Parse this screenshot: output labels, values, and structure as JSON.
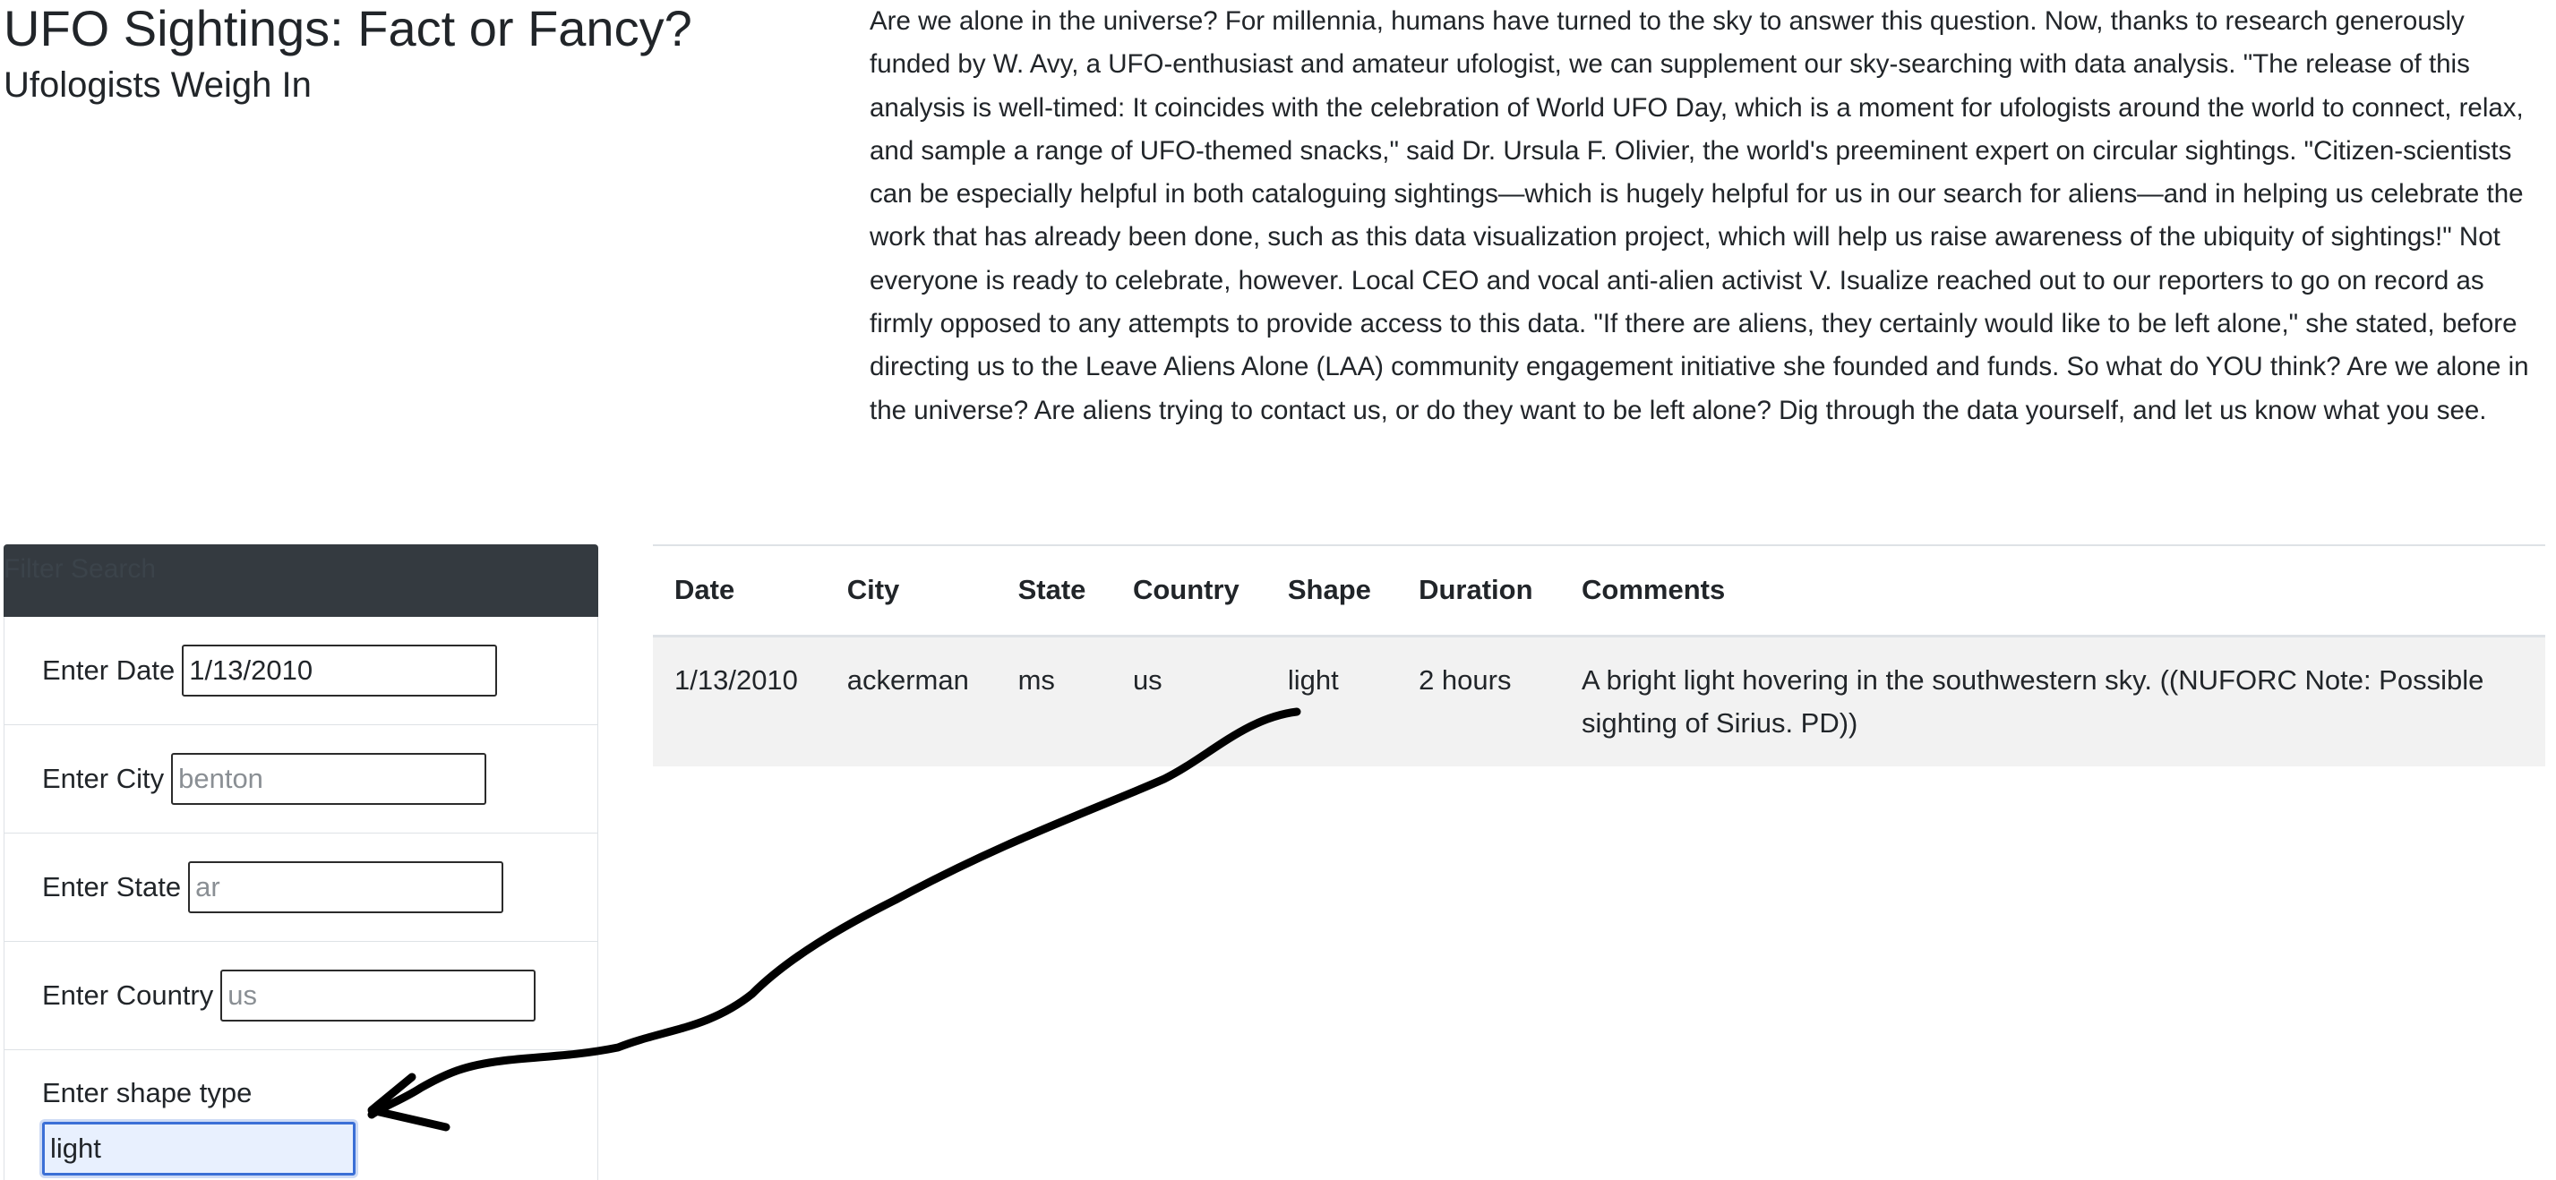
{
  "header": {
    "title": "UFO Sightings: Fact or Fancy?",
    "subtitle": "Ufologists Weigh In"
  },
  "intro": {
    "text": "Are we alone in the universe? For millennia, humans have turned to the sky to answer this question. Now, thanks to research generously funded by W. Avy, a UFO-enthusiast and amateur ufologist, we can supplement our sky-searching with data analysis. \"The release of this analysis is well-timed: It coincides with the celebration of World UFO Day, which is a moment for ufologists around the world to connect, relax, and sample a range of UFO-themed snacks,\" said Dr. Ursula F. Olivier, the world's preeminent expert on circular sightings. \"Citizen-scientists can be especially helpful in both cataloguing sightings—which is hugely helpful for us in our search for aliens—and in helping us celebrate the work that has already been done, such as this data visualization project, which will help us raise awareness of the ubiquity of sightings!\" Not everyone is ready to celebrate, however. Local CEO and vocal anti-alien activist V. Isualize reached out to our reporters to go on record as firmly opposed to any attempts to provide access to this data. \"If there are aliens, they certainly would like to be left alone,\" she stated, before directing us to the Leave Aliens Alone (LAA) community engagement initiative she founded and funds. So what do YOU think? Are we alone in the universe? Are aliens trying to contact us, or do they want to be left alone? Dig through the data yourself, and let us know what you see."
  },
  "filters": {
    "header": "Filter Search",
    "date": {
      "label": "Enter Date",
      "value": "1/13/2010",
      "placeholder": ""
    },
    "city": {
      "label": "Enter City",
      "value": "",
      "placeholder": "benton"
    },
    "state": {
      "label": "Enter State",
      "value": "",
      "placeholder": "ar"
    },
    "country": {
      "label": "Enter Country",
      "value": "",
      "placeholder": "us"
    },
    "shape": {
      "label": "Enter shape type",
      "value": "light",
      "placeholder": ""
    }
  },
  "table": {
    "columns": [
      "Date",
      "City",
      "State",
      "Country",
      "Shape",
      "Duration",
      "Comments"
    ],
    "rows": [
      {
        "date": "1/13/2010",
        "city": "ackerman",
        "state": "ms",
        "country": "us",
        "shape": "light",
        "duration": "2 hours",
        "comments": "A bright light hovering in the southwestern sky. ((NUFORC Note: Possible sighting of Sirius. PD))"
      }
    ]
  },
  "colors": {
    "filter_header_bg": "#343a40",
    "focused_input_border": "#3b6fd6",
    "row_bg": "#f2f2f2",
    "annotation_stroke": "#000000"
  }
}
